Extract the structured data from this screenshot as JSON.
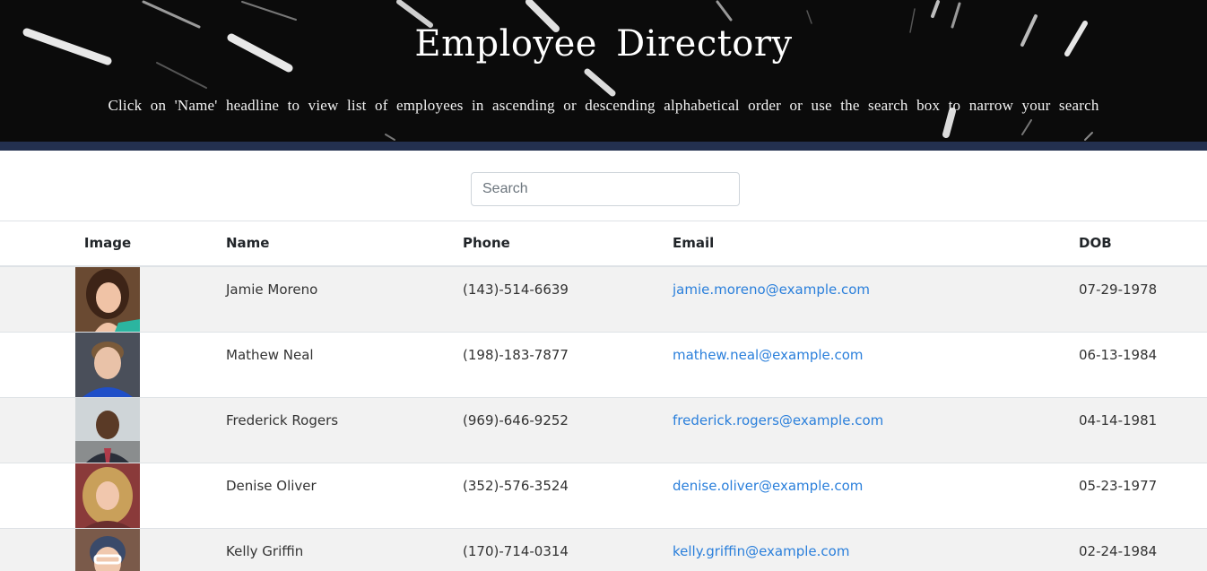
{
  "header": {
    "title": "Employee  Directory",
    "subtitle": "Click on 'Name' headline to view list of employees in ascending or descending alphabetical order or use the search box to narrow your search"
  },
  "search": {
    "placeholder": "Search",
    "value": ""
  },
  "table": {
    "columns": {
      "image": "Image",
      "name": "Name",
      "phone": "Phone",
      "email": "Email",
      "dob": "DOB"
    },
    "rows": [
      {
        "name": "Jamie Moreno",
        "phone": "(143)-514-6639",
        "email": "jamie.moreno@example.com",
        "dob": "07-29-1978"
      },
      {
        "name": "Mathew Neal",
        "phone": "(198)-183-7877",
        "email": "mathew.neal@example.com",
        "dob": "06-13-1984"
      },
      {
        "name": "Frederick Rogers",
        "phone": "(969)-646-9252",
        "email": "frederick.rogers@example.com",
        "dob": "04-14-1981"
      },
      {
        "name": "Denise Oliver",
        "phone": "(352)-576-3524",
        "email": "denise.oliver@example.com",
        "dob": "05-23-1977"
      },
      {
        "name": "Kelly Griffin",
        "phone": "(170)-714-0314",
        "email": "kelly.griffin@example.com",
        "dob": "02-24-1984"
      }
    ]
  },
  "colors": {
    "banner_bg": "#0b0b0b",
    "banner_rule": "#23304f",
    "link": "#2a7fdb",
    "stripe": "#f2f2f2"
  }
}
